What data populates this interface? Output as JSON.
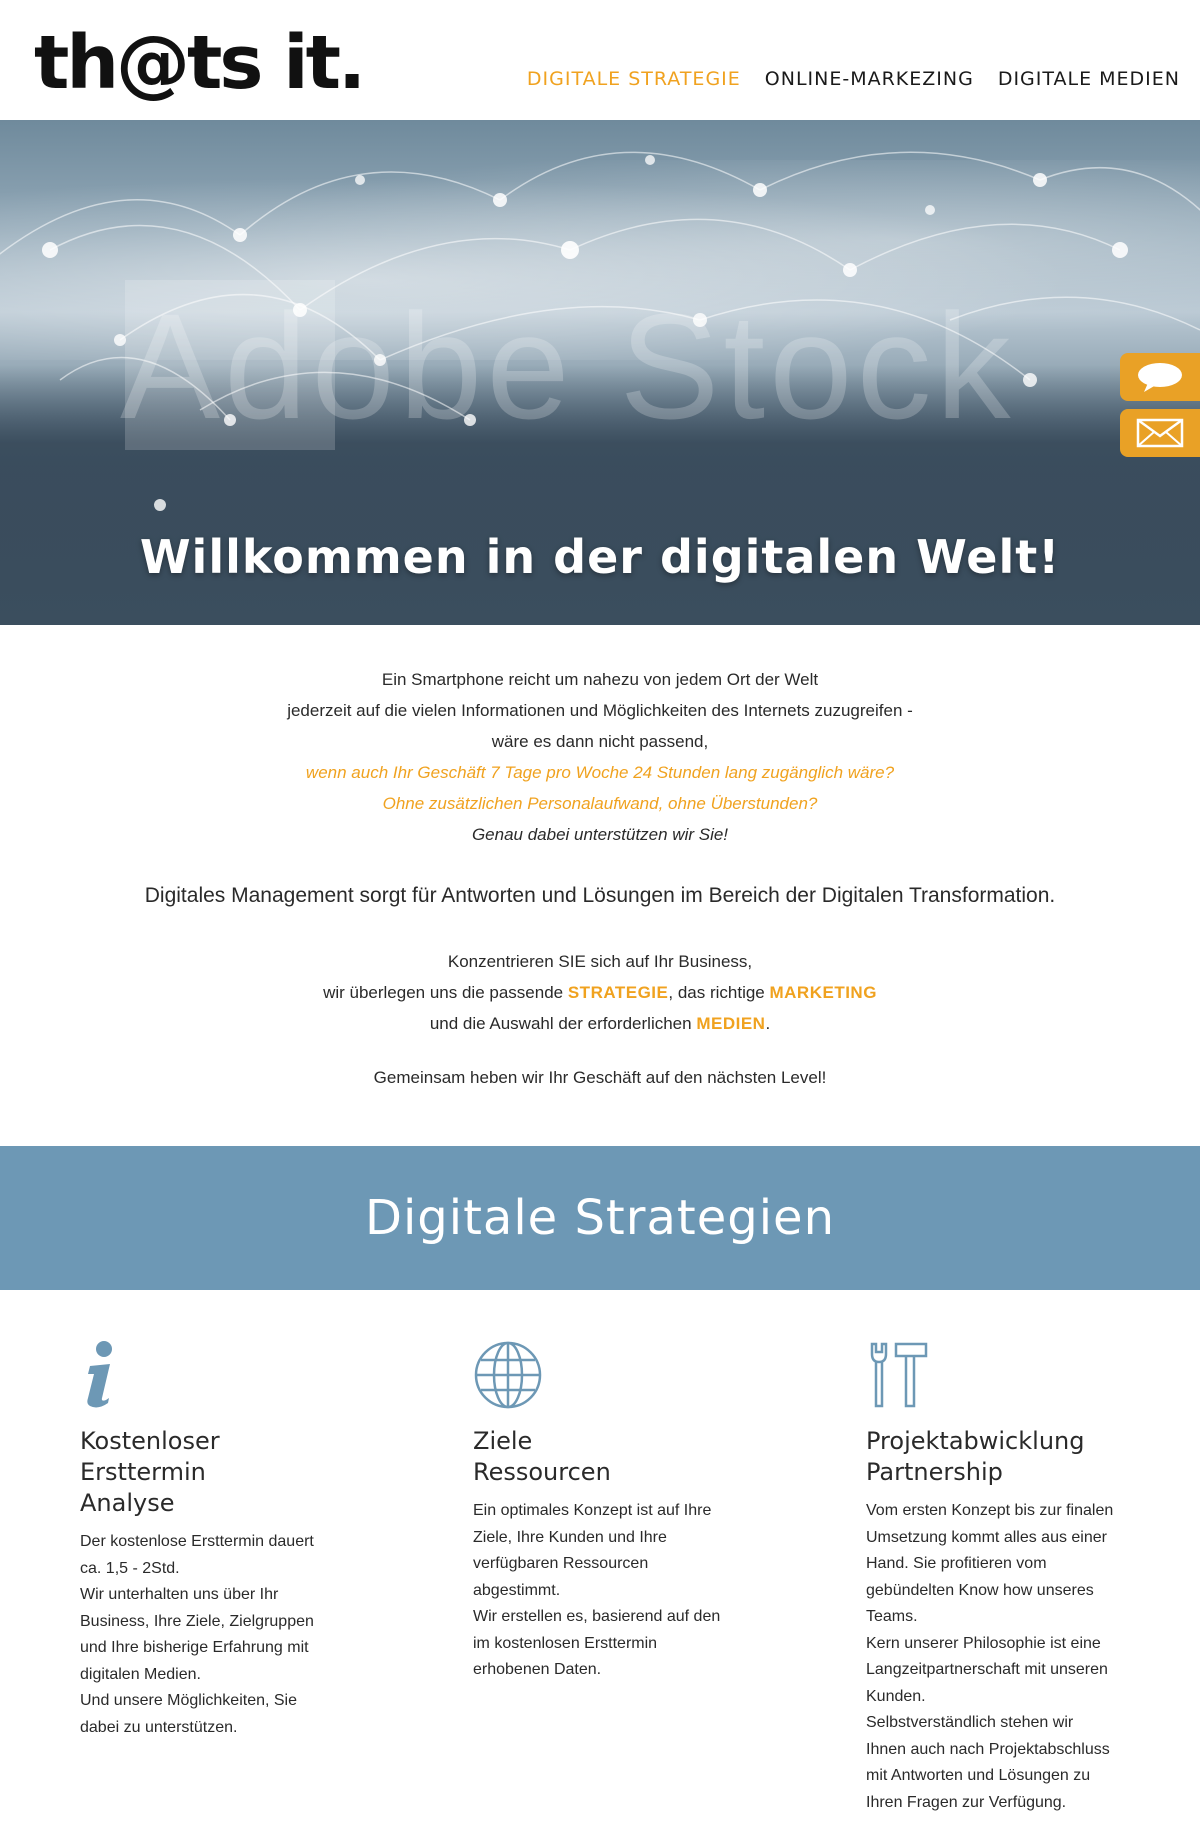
{
  "header": {
    "logo": "th@ts it.",
    "nav": [
      {
        "label": "DIGITALE STRATEGIE",
        "active": true
      },
      {
        "label": "ONLINE-MARKEZING",
        "active": false
      },
      {
        "label": "DIGITALE MEDIEN",
        "active": false
      }
    ]
  },
  "hero": {
    "watermark": "Adobe Stock",
    "title": "Willkommen in der digitalen Welt!"
  },
  "side_buttons": [
    {
      "icon": "speech-bubble-icon"
    },
    {
      "icon": "envelope-icon"
    }
  ],
  "intro": {
    "line1": "Ein Smartphone reicht um nahezu von jedem Ort der Welt",
    "line2": "jederzeit auf die vielen Informationen und Möglichkeiten des Internets zuzugreifen -",
    "line3": "wäre es dann nicht passend,",
    "line4": "wenn auch Ihr Geschäft 7 Tage pro Woche 24 Stunden lang zugänglich wäre?",
    "line5": "Ohne zusätzlichen Personalaufwand, ohne Überstunden?",
    "line6": "Genau dabei unterstützen wir Sie!"
  },
  "lead": "Digitales Management sorgt für Antworten und Lösungen im Bereich der Digitalen Transformation.",
  "focus": {
    "line1": "Konzentrieren SIE sich auf Ihr Business,",
    "line2_a": "wir überlegen uns die passende ",
    "line2_hl1": "STRATEGIE",
    "line2_b": ", das richtige ",
    "line2_hl2": "MARKETING",
    "line3_a": "und die Auswahl der erforderlichen ",
    "line3_hl": "MEDIEN",
    "line3_b": "."
  },
  "together": "Gemeinsam heben wir Ihr Geschäft auf den nächsten Level!",
  "band_title": "Digitale Strategien",
  "colors": {
    "accent": "#f0a21f",
    "band": "#6d98b5",
    "icon": "#6d98b5"
  },
  "columns": [
    {
      "icon": "info-icon",
      "title_lines": [
        "Kostenloser",
        "Ersttermin",
        "Analyse"
      ],
      "text_lines": [
        "Der kostenlose Ersttermin dauert",
        "ca. 1,5 - 2Std.",
        "Wir unterhalten uns über Ihr",
        "Business, Ihre Ziele, Zielgruppen",
        "und Ihre bisherige Erfahrung mit",
        "digitalen Medien.",
        "Und unsere Möglichkeiten, Sie",
        "dabei zu unterstützen."
      ]
    },
    {
      "icon": "globe-icon",
      "title_lines": [
        "Ziele",
        "Ressourcen"
      ],
      "text_lines": [
        "Ein optimales Konzept ist auf Ihre",
        "Ziele, Ihre Kunden und Ihre",
        "verfügbaren Ressourcen",
        "abgestimmt.",
        "Wir erstellen es, basierend auf den",
        "im kostenlosen Ersttermin",
        "erhobenen Daten."
      ]
    },
    {
      "icon": "tools-icon",
      "title_lines": [
        "Projektabwicklung",
        "Partnership"
      ],
      "text_lines": [
        "Vom ersten Konzept bis zur finalen",
        "Umsetzung kommt alles aus einer",
        "Hand. Sie profitieren vom",
        "gebündelten Know how unseres",
        "Teams.",
        "Kern unserer Philosophie ist eine",
        "Langzeitpartnerschaft mit unseren",
        "Kunden.",
        "Selbstverständlich stehen wir",
        "Ihnen auch nach Projektabschluss",
        "mit Antworten und Lösungen zu",
        "Ihren Fragen zur Verfügung."
      ]
    }
  ]
}
